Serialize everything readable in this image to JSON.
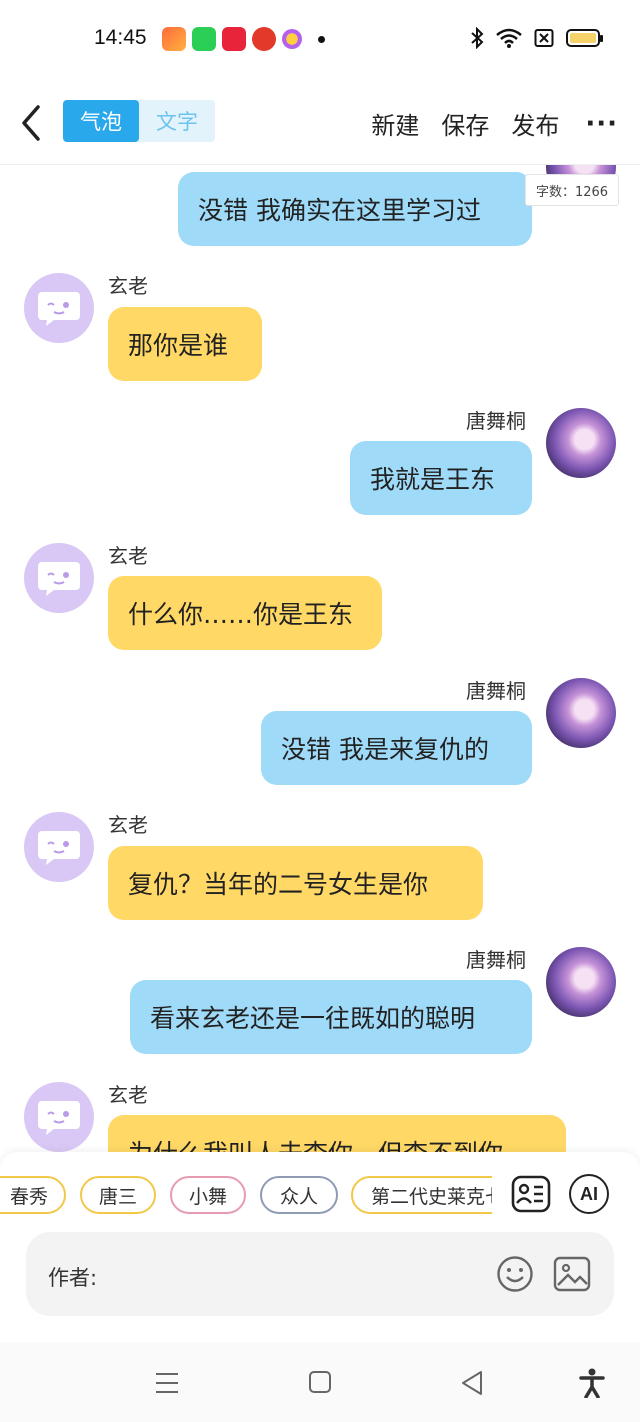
{
  "status_bar": {
    "time": "14:45",
    "notification_apps": [
      "app-icon-red",
      "app-icon-iqiyi",
      "app-icon-pinduoduo",
      "app-icon-hongbao",
      "app-icon-coins"
    ],
    "sys_icons": [
      "bluetooth-icon",
      "wifi-icon",
      "sim-off-icon",
      "battery-icon"
    ]
  },
  "toolbar": {
    "tabs": [
      {
        "label": "气泡",
        "active": true
      },
      {
        "label": "文字",
        "active": false
      }
    ],
    "new_label": "新建",
    "save_label": "保存",
    "publish_label": "发布",
    "more_label": "···"
  },
  "word_count": "字数：1266",
  "messages": [
    {
      "side": "right",
      "speaker": "",
      "text": "没错 我确实在这里学习过"
    },
    {
      "side": "left",
      "speaker": "玄老",
      "text": "那你是谁"
    },
    {
      "side": "right",
      "speaker": "唐舞桐",
      "text": "我就是王东"
    },
    {
      "side": "left",
      "speaker": "玄老",
      "text": "什么你……你是王东"
    },
    {
      "side": "right",
      "speaker": "唐舞桐",
      "text": "没错 我是来复仇的"
    },
    {
      "side": "left",
      "speaker": "玄老",
      "text": "复仇？当年的二号女生是你"
    },
    {
      "side": "right",
      "speaker": "唐舞桐",
      "text": "看来玄老还是一往既如的聪明"
    },
    {
      "side": "left",
      "speaker": "玄老",
      "text": "为什么我叫人去查你，但查不到你"
    }
  ],
  "character_chips": [
    "春秀",
    "唐三",
    "小舞",
    "众人",
    "第二代史莱克七怪"
  ],
  "ai_label": "AI",
  "input": {
    "label": "作者:"
  },
  "colors": {
    "accent": "#2aa8ec",
    "left_bubble": "#ffd866",
    "right_bubble": "#9fdaf8"
  }
}
